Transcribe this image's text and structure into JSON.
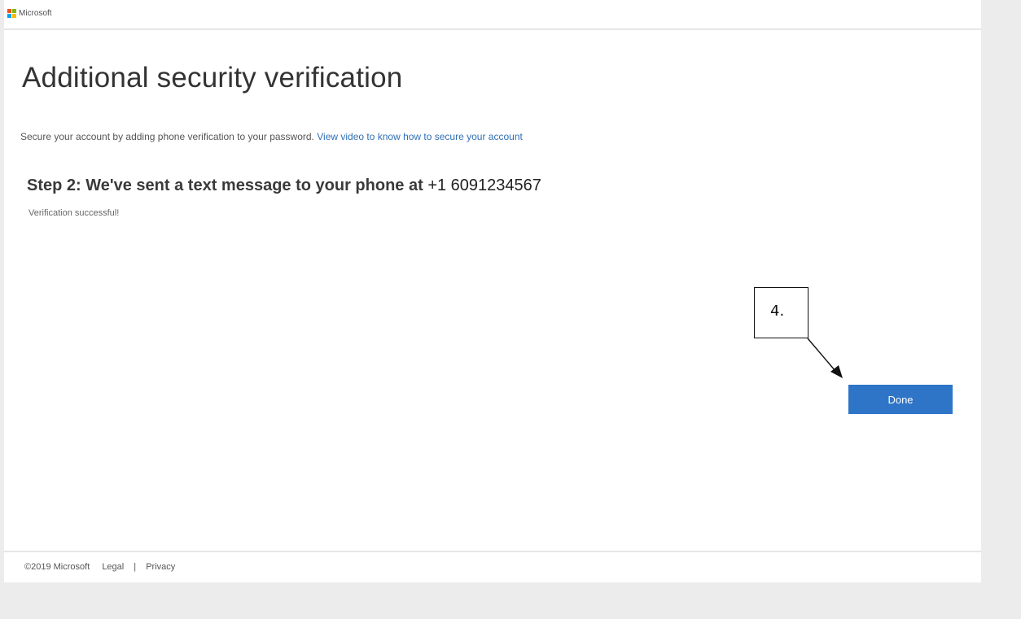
{
  "header": {
    "brand": "Microsoft",
    "logo_colors": [
      "#f25022",
      "#7fba00",
      "#00a4ef",
      "#ffb900"
    ]
  },
  "main": {
    "title": "Additional security verification",
    "subtitle_text": "Secure your account by adding phone verification to your password.",
    "subtitle_link": "View video to know how to secure your account",
    "step_text": "Step 2: We've sent a text message to your phone at",
    "phone_number": "+1 6091234567",
    "status": "Verification successful!",
    "done_label": "Done"
  },
  "annotation": {
    "callout_label": "4."
  },
  "footer": {
    "copyright": "©2019 Microsoft",
    "legal": "Legal",
    "separator": "|",
    "privacy": "Privacy"
  },
  "colors": {
    "accent": "#2e75c7",
    "link": "#2f6fb5",
    "background": "#ececec"
  }
}
